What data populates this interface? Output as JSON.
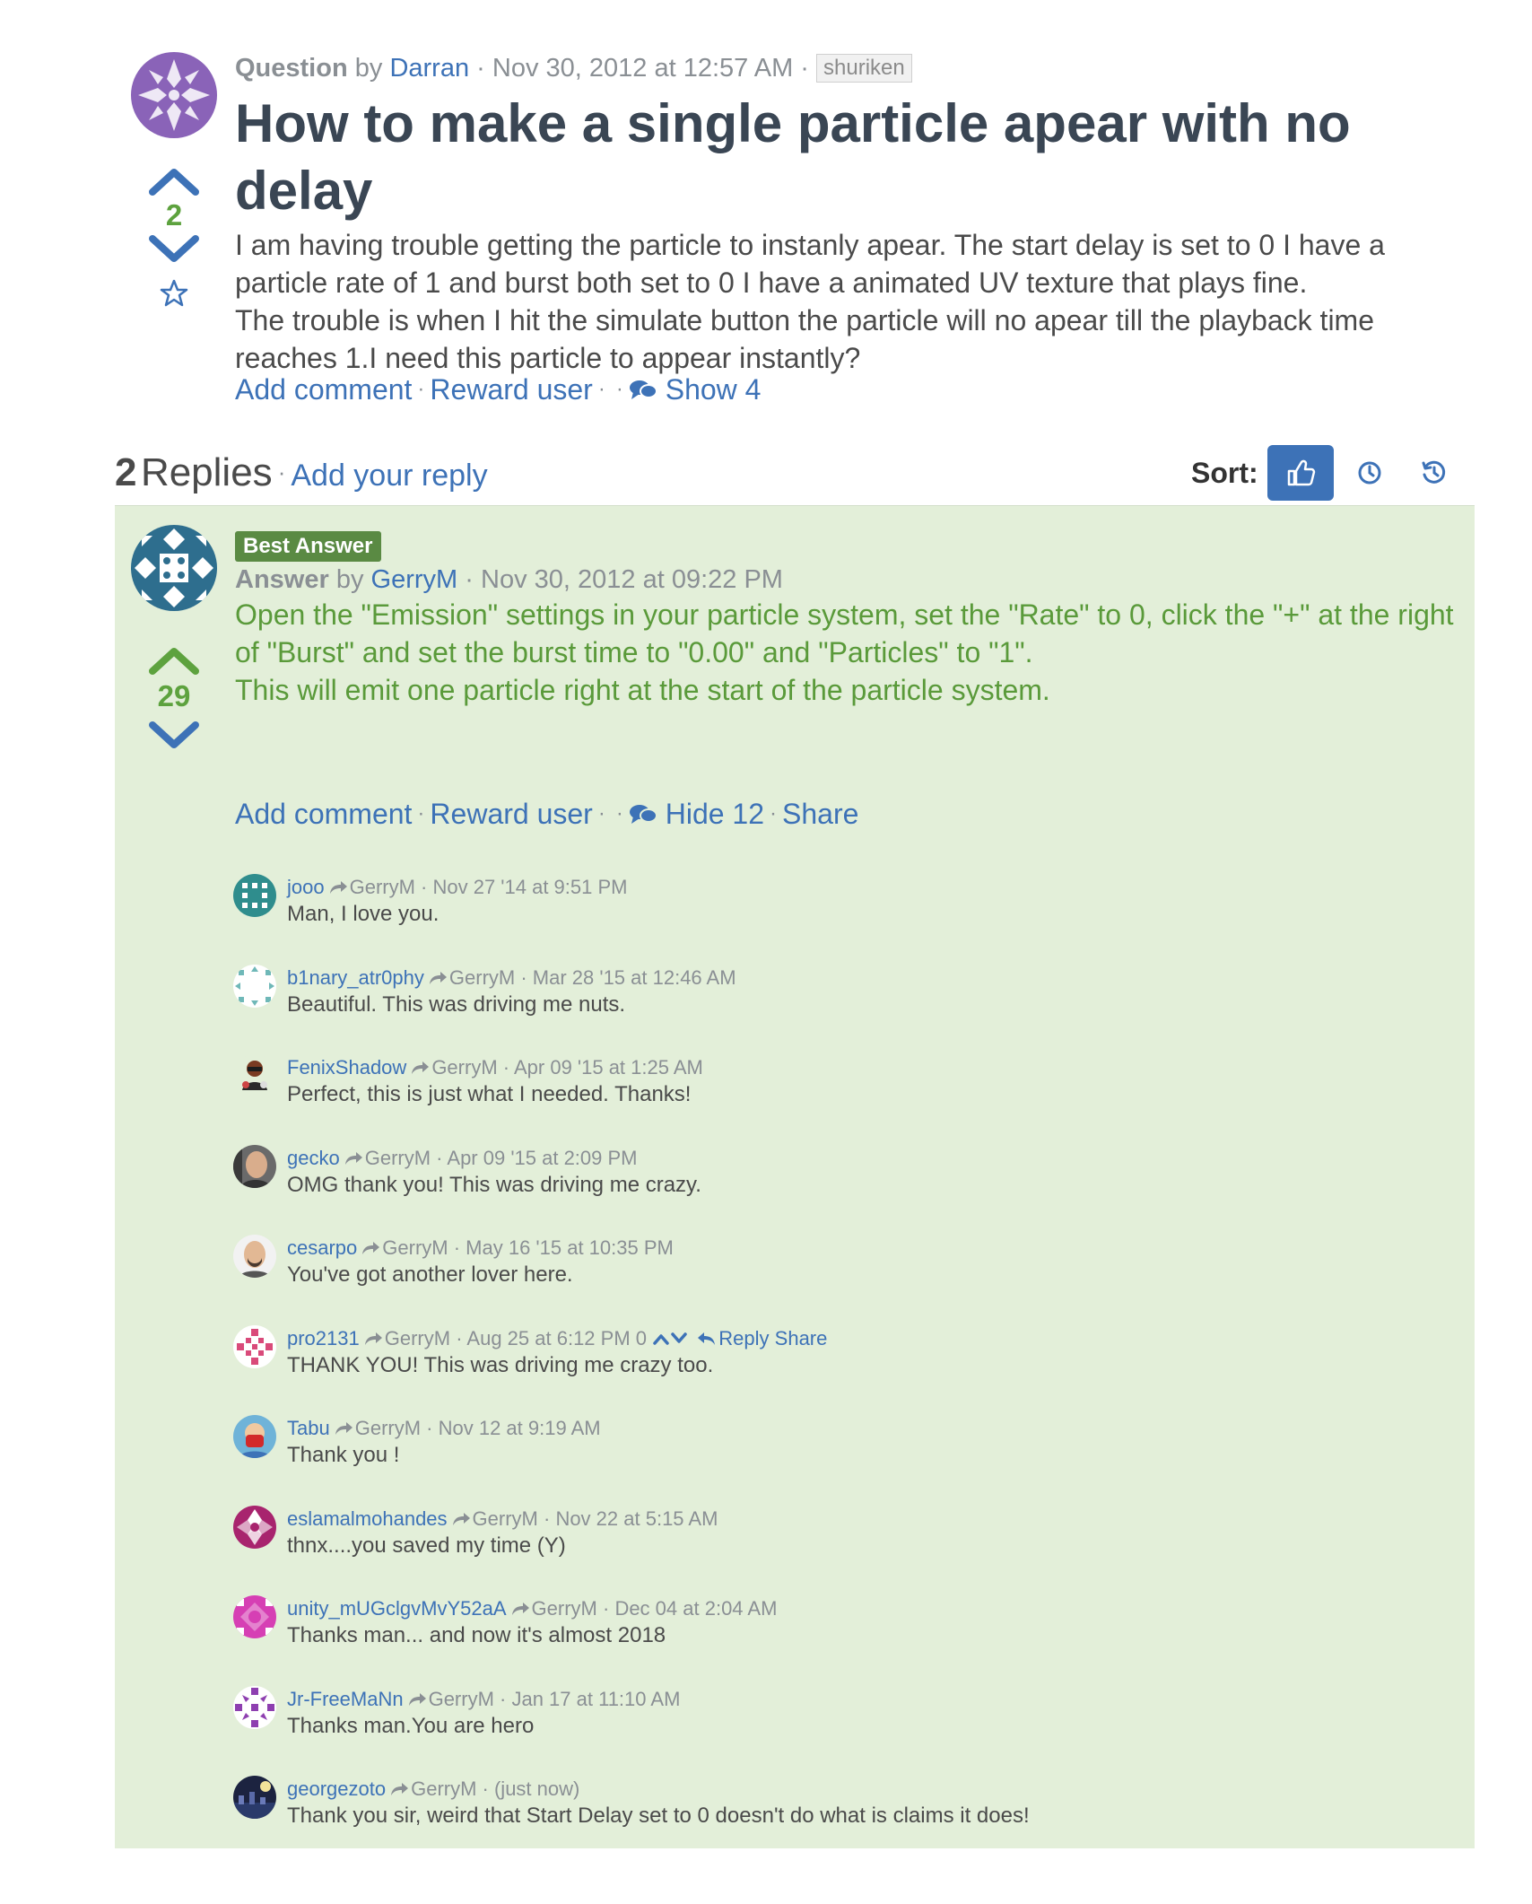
{
  "question": {
    "kind": "Question",
    "by": "by",
    "author": "Darran",
    "date": "Nov 30, 2012 at 12:57 AM",
    "tag": "shuriken",
    "title": "How to make a single particle apear with no delay",
    "body": [
      "I am having trouble getting the particle to instanly apear. The start delay is set to 0 I have a particle rate of 1 and burst both set to 0 I have a animated UV texture that plays fine.",
      "The trouble is when I hit the simulate button the particle will no apear till the playback time reaches 1.I need this particle to appear instantly?"
    ],
    "votes": "2",
    "actions": {
      "add_comment": "Add comment",
      "reward_user": "Reward user",
      "show": "Show 4"
    },
    "avatar_color": "#8a63b8"
  },
  "replies_header": {
    "count": "2",
    "word": "Replies",
    "add_reply": "Add your reply",
    "sort_label": "Sort:"
  },
  "answer": {
    "badge": "Best Answer",
    "kind": "Answer",
    "by": "by",
    "author": "GerryM",
    "date": "Nov 30, 2012 at 09:22 PM",
    "votes": "29",
    "body": [
      "Open the \"Emission\" settings in your particle system, set the \"Rate\" to 0, click the \"+\" at the right of \"Burst\" and set the burst time to \"0.00\" and \"Particles\" to \"1\".",
      "This will emit one particle right at the start of the particle system."
    ],
    "actions": {
      "add_comment": "Add comment",
      "reward_user": "Reward user",
      "hide": "Hide 12",
      "share": "Share"
    },
    "avatar_color": "#2e6e8e"
  },
  "comments": [
    {
      "author": "jooo",
      "to": "GerryM",
      "date": "Nov 27 '14 at 9:51 PM",
      "text": "Man, I love you.",
      "avatar": "teal-grid"
    },
    {
      "author": "b1nary_atr0phy",
      "to": "GerryM",
      "date": "Mar 28 '15 at 12:46 AM",
      "text": "Beautiful. This was driving me nuts.",
      "avatar": "teal-outline"
    },
    {
      "author": "FenixShadow",
      "to": "GerryM",
      "date": "Apr 09 '15 at 1:25 AM",
      "text": "Perfect, this is just what I needed. Thanks!",
      "avatar": "character"
    },
    {
      "author": "gecko",
      "to": "GerryM",
      "date": "Apr 09 '15 at 2:09 PM",
      "text": "OMG thank you! This was driving me crazy.",
      "avatar": "photo-man"
    },
    {
      "author": "cesarpo",
      "to": "GerryM",
      "date": "May 16 '15 at 10:35 PM",
      "text": "You've got another lover here.",
      "avatar": "photo-bald"
    },
    {
      "author": "pro2131",
      "to": "GerryM",
      "date": "Aug 25 at 6:12 PM",
      "text": "THANK YOU! This was driving me crazy too.",
      "avatar": "pink-pattern",
      "votes": "0",
      "reply": "Reply",
      "share": "Share"
    },
    {
      "author": "Tabu",
      "to": "GerryM",
      "date": "Nov 12 at 9:19 AM",
      "text": "Thank you !",
      "avatar": "cartoon"
    },
    {
      "author": "eslamalmohandes",
      "to": "GerryM",
      "date": "Nov 22 at 5:15 AM",
      "text": "thnx....you saved my time (Y)",
      "avatar": "magenta-pattern"
    },
    {
      "author": "unity_mUGclgvMvY52aA",
      "to": "GerryM",
      "date": "Dec 04 at 2:04 AM",
      "text": "Thanks man... and now it's almost 2018",
      "avatar": "pink-pattern-2"
    },
    {
      "author": "Jr-FreeMaNn",
      "to": "GerryM",
      "date": "Jan 17 at 11:10 AM",
      "text": "Thanks man.You are hero",
      "avatar": "purple-pattern"
    },
    {
      "author": "georgezoto",
      "to": "GerryM",
      "date": "(just now)",
      "text": "Thank you sir, weird that Start Delay set to 0 doesn't do what is claims it does!",
      "avatar": "photo-night"
    }
  ],
  "colors": {
    "link": "#3d72b7",
    "vote_count": "#5da23e",
    "answer_bg": "#e3efd9",
    "answer_text": "#5a9a3a",
    "badge": "#5a8a43",
    "title": "#3a4654"
  }
}
